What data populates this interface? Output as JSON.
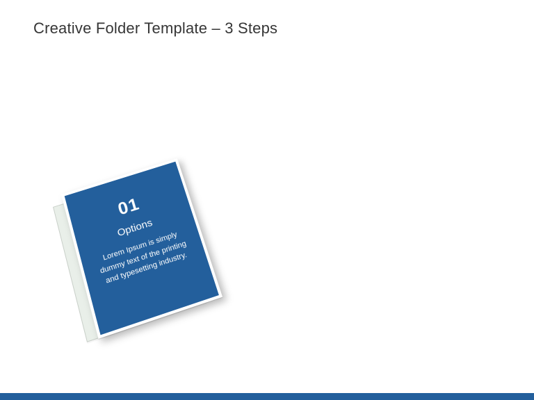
{
  "header": {
    "title": "Creative Folder Template – 3 Steps"
  },
  "card": {
    "number": "01",
    "subtitle": "Options",
    "body": "Lorem Ipsum is simply dummy text of the printing and typesetting industry."
  },
  "colors": {
    "accent": "#235f9c",
    "text": "#363636"
  }
}
